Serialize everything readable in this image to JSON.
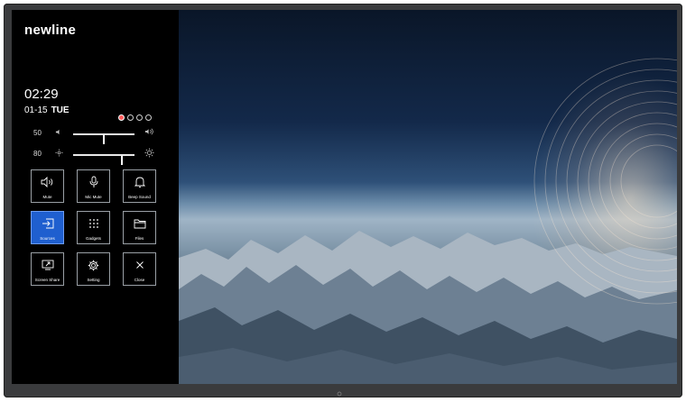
{
  "brand": {
    "logo": "newline"
  },
  "clock": {
    "time": "02:29",
    "date": "01-15",
    "day": "TUE"
  },
  "status_icons": [
    "record-icon",
    "pen-icon",
    "screen-icon",
    "help-icon"
  ],
  "volume": {
    "value": "50",
    "level": 0.5
  },
  "brightness": {
    "value": "80",
    "level": 0.8
  },
  "tiles": [
    {
      "label": "Mute",
      "icon": "speaker-icon",
      "active": false
    },
    {
      "label": "Mic Mute",
      "icon": "microphone-icon",
      "active": false
    },
    {
      "label": "Beep Sound",
      "icon": "bell-icon",
      "active": false
    },
    {
      "label": "Sources",
      "icon": "input-source-icon",
      "active": true
    },
    {
      "label": "Gadgets",
      "icon": "grid-icon",
      "active": false
    },
    {
      "label": "Files",
      "icon": "folder-icon",
      "active": false
    },
    {
      "label": "Screen Share",
      "icon": "screen-share-icon",
      "active": false
    },
    {
      "label": "Setting",
      "icon": "gear-icon",
      "active": false
    },
    {
      "label": "Close",
      "icon": "close-icon",
      "active": false
    }
  ],
  "colors": {
    "panel": "#000000",
    "accent": "#1f5fcf",
    "bezel": "#3a3b3d"
  }
}
